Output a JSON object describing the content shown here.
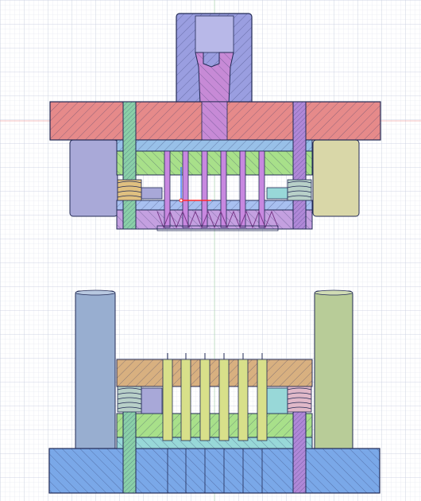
{
  "viewport": {
    "background": "#ffffff",
    "grid_minor_color": "#dfe3ee",
    "grid_major_color": "#c6ccdd",
    "axis_red": "#f08a8a",
    "axis_green": "#a8d8a8"
  },
  "parts": {
    "upper_die": {
      "shank": "#9a9ee0",
      "shank_core": "#c78ad6",
      "top_plate": "#e68a8a",
      "guide_bushing_left": "#a9a9d8",
      "guide_bushing_right": "#d9d7a8",
      "punch_holder": "#98c0e8",
      "backing_plate": "#a8e08a",
      "stripper_plate": "#a8c0f0",
      "stripper_lower": "#c4a0e0",
      "spring": "#e0c080",
      "guide_post_left": "#8ad0a8",
      "guide_post_right": "#b088d8",
      "punch": "#c888e0"
    },
    "lower_die": {
      "die_shoe": "#7aa8e8",
      "die_plate": "#a8e08a",
      "die_cavity": "#98d8d8",
      "stripper": "#d8b080",
      "pierce_pin": "#d8e08a",
      "spring": "#b8d0c8",
      "guide_pillar_left": "#98aed0",
      "guide_pillar_right": "#b8cc98",
      "guide_post_left": "#8ad0a8",
      "guide_post_right": "#b088d8"
    },
    "outline": "#222a55"
  }
}
